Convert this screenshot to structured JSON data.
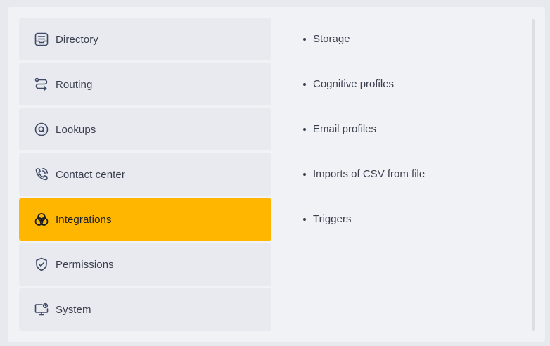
{
  "menu": {
    "items": [
      {
        "label": "Directory",
        "icon": "directory-icon",
        "active": false
      },
      {
        "label": "Routing",
        "icon": "routing-icon",
        "active": false
      },
      {
        "label": "Lookups",
        "icon": "lookups-icon",
        "active": false
      },
      {
        "label": "Contact center",
        "icon": "contact-center-icon",
        "active": false
      },
      {
        "label": "Integrations",
        "icon": "integrations-icon",
        "active": true
      },
      {
        "label": "Permissions",
        "icon": "permissions-icon",
        "active": false
      },
      {
        "label": "System",
        "icon": "system-icon",
        "active": false
      }
    ]
  },
  "submenu": {
    "items": [
      {
        "label": "Storage"
      },
      {
        "label": "Cognitive profiles"
      },
      {
        "label": "Email profiles"
      },
      {
        "label": "Imports of CSV from file"
      },
      {
        "label": "Triggers"
      }
    ]
  },
  "colors": {
    "accent": "#ffb600",
    "item_bg": "#e9eaef",
    "panel_bg": "#f1f2f6",
    "text": "#3a3f4e"
  }
}
